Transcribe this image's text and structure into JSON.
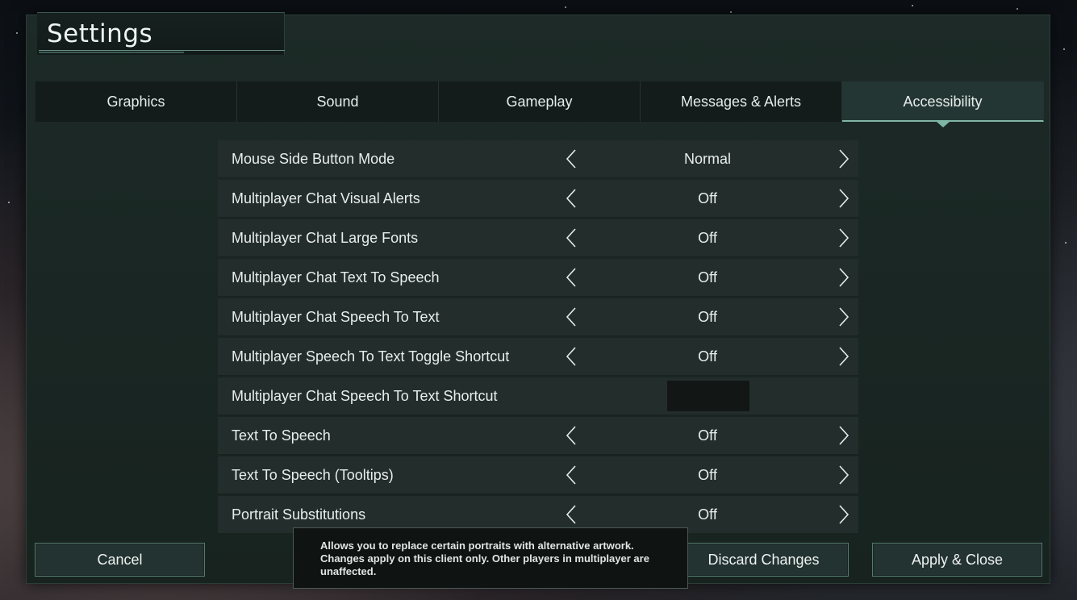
{
  "title": "Settings",
  "tabs": [
    {
      "label": "Graphics",
      "active": false
    },
    {
      "label": "Sound",
      "active": false
    },
    {
      "label": "Gameplay",
      "active": false
    },
    {
      "label": "Messages & Alerts",
      "active": false
    },
    {
      "label": "Accessibility",
      "active": true
    }
  ],
  "rows": [
    {
      "label": "Mouse Side Button Mode",
      "value": "Normal",
      "type": "selector"
    },
    {
      "label": "Multiplayer Chat Visual Alerts",
      "value": "Off",
      "type": "selector"
    },
    {
      "label": "Multiplayer Chat Large Fonts",
      "value": "Off",
      "type": "selector"
    },
    {
      "label": "Multiplayer Chat Text To Speech",
      "value": "Off",
      "type": "selector"
    },
    {
      "label": "Multiplayer Chat Speech To Text",
      "value": "Off",
      "type": "selector"
    },
    {
      "label": "Multiplayer Speech To Text Toggle Shortcut",
      "value": "Off",
      "type": "selector"
    },
    {
      "label": "Multiplayer Chat Speech To Text Shortcut",
      "value": "",
      "type": "keybind"
    },
    {
      "label": "Text To Speech",
      "value": "Off",
      "type": "selector"
    },
    {
      "label": "Text To Speech (Tooltips)",
      "value": "Off",
      "type": "selector"
    },
    {
      "label": "Portrait Substitutions",
      "value": "Off",
      "type": "selector"
    }
  ],
  "tooltip": {
    "line1": "Allows you to replace certain portraits with alternative artwork.",
    "line2": "Changes apply on this client only. Other players in multiplayer are",
    "line3": "unaffected."
  },
  "buttons": {
    "cancel": "Cancel",
    "discard": "Discard Changes",
    "apply": "Apply & Close"
  },
  "colors": {
    "accent": "#7fb5a6",
    "row_bg": "#232d2c",
    "panel_bg": "#1a2724"
  }
}
